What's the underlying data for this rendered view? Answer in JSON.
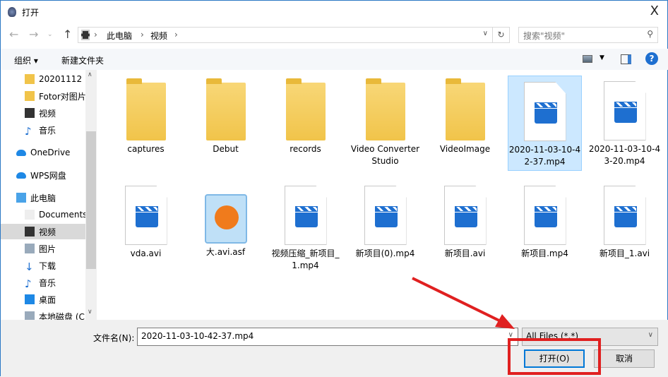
{
  "window": {
    "title": "打开",
    "close": "X"
  },
  "address": {
    "crumbs": [
      "此电脑",
      "视频"
    ],
    "search_placeholder": "搜索\"视频\""
  },
  "toolbar": {
    "organize": "组织 ▾",
    "new_folder": "新建文件夹",
    "help": "?"
  },
  "nav": [
    {
      "label": "20201112",
      "icon": "folder"
    },
    {
      "label": "Fotor对图片",
      "icon": "folder"
    },
    {
      "label": "视频",
      "icon": "video"
    },
    {
      "label": "音乐",
      "icon": "music"
    },
    {
      "label": "OneDrive",
      "icon": "cloud"
    },
    {
      "label": "WPS网盘",
      "icon": "cloud"
    },
    {
      "label": "此电脑",
      "icon": "pc"
    },
    {
      "label": "Documents",
      "icon": "doc"
    },
    {
      "label": "视频",
      "icon": "video",
      "selected": true
    },
    {
      "label": "图片",
      "icon": "picture"
    },
    {
      "label": "下载",
      "icon": "download"
    },
    {
      "label": "音乐",
      "icon": "music"
    },
    {
      "label": "桌面",
      "icon": "desktop"
    },
    {
      "label": "本地磁盘 (C",
      "icon": "drive"
    }
  ],
  "files": [
    {
      "name": "captures",
      "type": "folder"
    },
    {
      "name": "Debut",
      "type": "folder"
    },
    {
      "name": "records",
      "type": "folder"
    },
    {
      "name": "Video Converter Studio",
      "type": "folder"
    },
    {
      "name": "VideoImage",
      "type": "folder"
    },
    {
      "name": "2020-11-03-10-42-37.mp4",
      "type": "video",
      "selected": true
    },
    {
      "name": "2020-11-03-10-43-20.mp4",
      "type": "video"
    },
    {
      "name": "vda.avi",
      "type": "video"
    },
    {
      "name": "大.avi.asf",
      "type": "player"
    },
    {
      "name": "视频压缩_新项目_1.mp4",
      "type": "video"
    },
    {
      "name": "新项目(0).mp4",
      "type": "video"
    },
    {
      "name": "新项目.avi",
      "type": "video"
    },
    {
      "name": "新项目.mp4",
      "type": "video"
    },
    {
      "name": "新项目_1.avi",
      "type": "video"
    }
  ],
  "bottom": {
    "filename_label": "文件名(N):",
    "filename_value": "2020-11-03-10-42-37.mp4",
    "filetype": "All Files (*.*)",
    "open": "打开(O)",
    "cancel": "取消"
  },
  "colors": {
    "accent": "#0078d7",
    "highlight": "#e02020",
    "selection": "#cce8ff"
  }
}
